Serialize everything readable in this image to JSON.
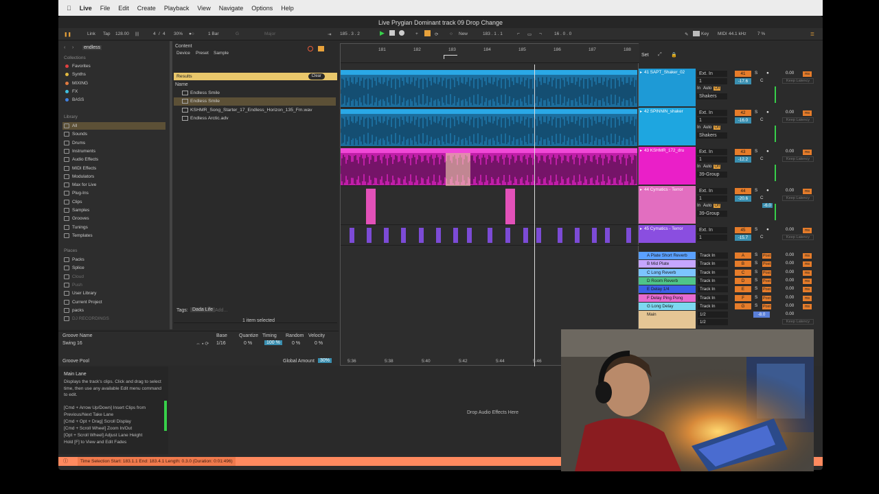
{
  "menubar": {
    "apple": "",
    "app": "Live",
    "items": [
      "File",
      "Edit",
      "Create",
      "Playback",
      "View",
      "Navigate",
      "Options",
      "Help"
    ]
  },
  "window_title": "Live Prygian Dominant track 09 Drop Change",
  "transport": {
    "link": "Link",
    "tap": "Tap",
    "tempo": "128.00",
    "sig_num": "4",
    "sig_den": "4",
    "swing": "30%",
    "quant": "1 Bar",
    "position": "185 . 3 . 2",
    "new_label": "New",
    "loop_start": "183 . 1 . 1",
    "loop_len": "16 . 0 . 0",
    "key_label": "Key",
    "midi_label": "MIDI",
    "sample_rate": "44.1 kHz",
    "cpu": "7 %",
    "key_value": "G",
    "scale_value": "Major"
  },
  "browser": {
    "search": "endless",
    "collections_title": "Collections",
    "collections": [
      {
        "label": "Favorites",
        "color": "#e04040"
      },
      {
        "label": "Synths",
        "color": "#e0b840"
      },
      {
        "label": "MIXING",
        "color": "#e07a40"
      },
      {
        "label": "FX",
        "color": "#40c0e0"
      },
      {
        "label": "BASS",
        "color": "#4080e0"
      }
    ],
    "library_title": "Library",
    "library": [
      "All",
      "Sounds",
      "Drums",
      "Instruments",
      "Audio Effects",
      "MIDI Effects",
      "Modulators",
      "Max for Live",
      "Plug-Ins",
      "Clips",
      "Samples",
      "Grooves",
      "Tunings",
      "Templates"
    ],
    "places_title": "Places",
    "places": [
      "Packs",
      "Splice",
      "Cloud",
      "Push",
      "User Library",
      "Current Project",
      "packs",
      "DJ RECORDINGS"
    ],
    "filter_tabs": {
      "content": "Content",
      "device": "Device",
      "preset": "Preset",
      "sample": "Sample"
    },
    "results_label": "Results",
    "clear_label": "Clear",
    "name_header": "Name",
    "results": [
      "Endless Smile",
      "Endless Smile",
      "KSHMR_Song_Starter_17_Endless_Horizon_135_Fm.wav",
      "Endless Arctic.adv"
    ],
    "tags_label": "Tags:",
    "tag_value": "Dada Life",
    "tag_add": "Add...",
    "status": "1 item selected"
  },
  "groove": {
    "headers": [
      "Groove Name",
      "Base",
      "Quantize",
      "Timing",
      "Random",
      "Velocity"
    ],
    "row": {
      "name": "Swing 16",
      "base": "1/16",
      "quantize": "0 %",
      "timing": "100 %",
      "random": "0 %",
      "velocity": "0 %"
    },
    "pool_label": "Groove Pool",
    "global_label": "Global Amount",
    "global_value": "30%"
  },
  "info": {
    "title": "Main Lane",
    "text": "Displays the track's clips. Click and drag to select time, then use any available Edit menu command to edit.",
    "shortcuts": [
      "[Cmd + Arrow Up/Down] Insert Clips from Previous/Next Take Lane",
      "[Cmd + Opt + Drag] Scroll Display",
      "[Cmd + Scroll Wheel] Zoom In/Out",
      "[Opt + Scroll Wheel] Adjust Lane Height",
      "Hold [F] to View and Edit Fades"
    ]
  },
  "drop_text": "Drop Audio Effects Here",
  "status_bar": "Time Selection   Start: 183.1.1   End: 183.4.1   Length: 0.3.0 (Duration: 0:01:496)",
  "arrangement": {
    "ruler": [
      "181",
      "182",
      "183",
      "184",
      "185",
      "186",
      "187",
      "188"
    ],
    "times": [
      "5:36",
      "5:38",
      "5:40",
      "5:42",
      "5:44",
      "5:46"
    ],
    "set_label": "Set"
  },
  "tracks": [
    {
      "name": "41 SAPT_Shaker_02",
      "color": "#1e9ad6",
      "input": "Ext. In",
      "ch": "1",
      "route": "Shakers",
      "num": "41",
      "gain": "-17.6",
      "vol": "0.00",
      "latency": "Keep Latency"
    },
    {
      "name": "42 SPINNIN_shaker",
      "color": "#1ea6e0",
      "input": "Ext. In",
      "ch": "1",
      "route": "Shakers",
      "num": "42",
      "gain": "-16.0",
      "vol": "0.00",
      "latency": "Keep Latency"
    },
    {
      "name": "43 KSHMR_172_dru",
      "color": "#ea1fc8",
      "input": "Ext. In",
      "ch": "1",
      "route": "39-Group",
      "num": "43",
      "gain": "-12.2",
      "vol": "0.00",
      "latency": "Keep Latency"
    },
    {
      "name": "44 Cymatics - Terror",
      "color": "#e26ec0",
      "input": "Ext. In",
      "ch": "1",
      "route": "39-Group",
      "num": "44",
      "gain": "-20.6",
      "vol": "0.00",
      "latency": "Keep Latency",
      "pan": "-6.0"
    },
    {
      "name": "45 Cymatics - Terror",
      "color": "#8a4ee0",
      "input": "Ext. In",
      "ch": "1",
      "route": "",
      "num": "45",
      "gain": "-15.7",
      "vol": "0.00",
      "latency": "Keep Latency"
    }
  ],
  "io_labels": {
    "in": "In",
    "auto": "Auto",
    "off": "Off"
  },
  "returns": [
    {
      "name": "A Plate Short Reverb",
      "color": "#5aa0ff",
      "letter": "A",
      "vol": "0.00"
    },
    {
      "name": "B Mid Plate",
      "color": "#c6a6ff",
      "letter": "B",
      "vol": "0.00"
    },
    {
      "name": "C Long Reverb",
      "color": "#7cc4ff",
      "letter": "C",
      "vol": "0.00"
    },
    {
      "name": "D Room Reverb",
      "color": "#4fc48a",
      "letter": "D",
      "vol": "0.00"
    },
    {
      "name": "E Delay 1/4",
      "color": "#3b60e8",
      "letter": "E",
      "vol": "0.00"
    },
    {
      "name": "F Delay Ping Pong",
      "color": "#e86bd0",
      "letter": "F",
      "vol": "0.00"
    },
    {
      "name": "G Long Delay",
      "color": "#7dd8f0",
      "letter": "G",
      "vol": "0.00"
    }
  ],
  "return_input": "Track In",
  "post_label": "Post",
  "main": {
    "name": "Main",
    "ch": "1/2",
    "vol": "0.00",
    "gain": "-8.0",
    "latency": "Keep Latency"
  }
}
